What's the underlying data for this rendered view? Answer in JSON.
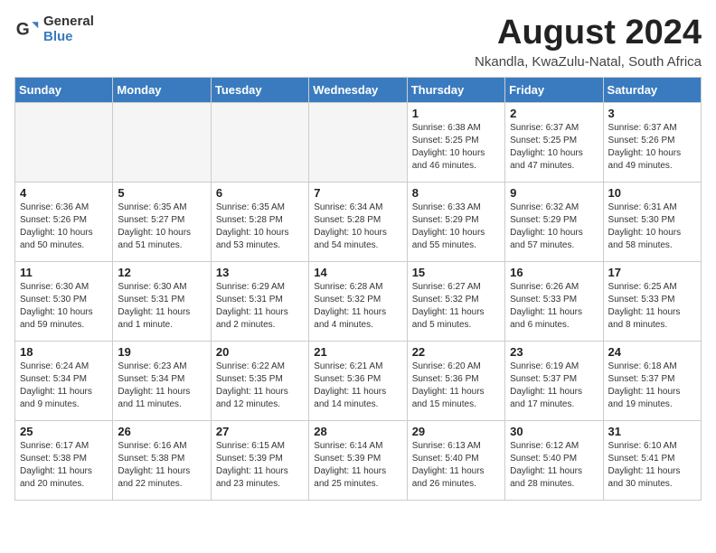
{
  "logo": {
    "general": "General",
    "blue": "Blue"
  },
  "title": "August 2024",
  "location": "Nkandla, KwaZulu-Natal, South Africa",
  "weekdays": [
    "Sunday",
    "Monday",
    "Tuesday",
    "Wednesday",
    "Thursday",
    "Friday",
    "Saturday"
  ],
  "weeks": [
    [
      {
        "day": "",
        "info": ""
      },
      {
        "day": "",
        "info": ""
      },
      {
        "day": "",
        "info": ""
      },
      {
        "day": "",
        "info": ""
      },
      {
        "day": "1",
        "info": "Sunrise: 6:38 AM\nSunset: 5:25 PM\nDaylight: 10 hours\nand 46 minutes."
      },
      {
        "day": "2",
        "info": "Sunrise: 6:37 AM\nSunset: 5:25 PM\nDaylight: 10 hours\nand 47 minutes."
      },
      {
        "day": "3",
        "info": "Sunrise: 6:37 AM\nSunset: 5:26 PM\nDaylight: 10 hours\nand 49 minutes."
      }
    ],
    [
      {
        "day": "4",
        "info": "Sunrise: 6:36 AM\nSunset: 5:26 PM\nDaylight: 10 hours\nand 50 minutes."
      },
      {
        "day": "5",
        "info": "Sunrise: 6:35 AM\nSunset: 5:27 PM\nDaylight: 10 hours\nand 51 minutes."
      },
      {
        "day": "6",
        "info": "Sunrise: 6:35 AM\nSunset: 5:28 PM\nDaylight: 10 hours\nand 53 minutes."
      },
      {
        "day": "7",
        "info": "Sunrise: 6:34 AM\nSunset: 5:28 PM\nDaylight: 10 hours\nand 54 minutes."
      },
      {
        "day": "8",
        "info": "Sunrise: 6:33 AM\nSunset: 5:29 PM\nDaylight: 10 hours\nand 55 minutes."
      },
      {
        "day": "9",
        "info": "Sunrise: 6:32 AM\nSunset: 5:29 PM\nDaylight: 10 hours\nand 57 minutes."
      },
      {
        "day": "10",
        "info": "Sunrise: 6:31 AM\nSunset: 5:30 PM\nDaylight: 10 hours\nand 58 minutes."
      }
    ],
    [
      {
        "day": "11",
        "info": "Sunrise: 6:30 AM\nSunset: 5:30 PM\nDaylight: 10 hours\nand 59 minutes."
      },
      {
        "day": "12",
        "info": "Sunrise: 6:30 AM\nSunset: 5:31 PM\nDaylight: 11 hours\nand 1 minute."
      },
      {
        "day": "13",
        "info": "Sunrise: 6:29 AM\nSunset: 5:31 PM\nDaylight: 11 hours\nand 2 minutes."
      },
      {
        "day": "14",
        "info": "Sunrise: 6:28 AM\nSunset: 5:32 PM\nDaylight: 11 hours\nand 4 minutes."
      },
      {
        "day": "15",
        "info": "Sunrise: 6:27 AM\nSunset: 5:32 PM\nDaylight: 11 hours\nand 5 minutes."
      },
      {
        "day": "16",
        "info": "Sunrise: 6:26 AM\nSunset: 5:33 PM\nDaylight: 11 hours\nand 6 minutes."
      },
      {
        "day": "17",
        "info": "Sunrise: 6:25 AM\nSunset: 5:33 PM\nDaylight: 11 hours\nand 8 minutes."
      }
    ],
    [
      {
        "day": "18",
        "info": "Sunrise: 6:24 AM\nSunset: 5:34 PM\nDaylight: 11 hours\nand 9 minutes."
      },
      {
        "day": "19",
        "info": "Sunrise: 6:23 AM\nSunset: 5:34 PM\nDaylight: 11 hours\nand 11 minutes."
      },
      {
        "day": "20",
        "info": "Sunrise: 6:22 AM\nSunset: 5:35 PM\nDaylight: 11 hours\nand 12 minutes."
      },
      {
        "day": "21",
        "info": "Sunrise: 6:21 AM\nSunset: 5:36 PM\nDaylight: 11 hours\nand 14 minutes."
      },
      {
        "day": "22",
        "info": "Sunrise: 6:20 AM\nSunset: 5:36 PM\nDaylight: 11 hours\nand 15 minutes."
      },
      {
        "day": "23",
        "info": "Sunrise: 6:19 AM\nSunset: 5:37 PM\nDaylight: 11 hours\nand 17 minutes."
      },
      {
        "day": "24",
        "info": "Sunrise: 6:18 AM\nSunset: 5:37 PM\nDaylight: 11 hours\nand 19 minutes."
      }
    ],
    [
      {
        "day": "25",
        "info": "Sunrise: 6:17 AM\nSunset: 5:38 PM\nDaylight: 11 hours\nand 20 minutes."
      },
      {
        "day": "26",
        "info": "Sunrise: 6:16 AM\nSunset: 5:38 PM\nDaylight: 11 hours\nand 22 minutes."
      },
      {
        "day": "27",
        "info": "Sunrise: 6:15 AM\nSunset: 5:39 PM\nDaylight: 11 hours\nand 23 minutes."
      },
      {
        "day": "28",
        "info": "Sunrise: 6:14 AM\nSunset: 5:39 PM\nDaylight: 11 hours\nand 25 minutes."
      },
      {
        "day": "29",
        "info": "Sunrise: 6:13 AM\nSunset: 5:40 PM\nDaylight: 11 hours\nand 26 minutes."
      },
      {
        "day": "30",
        "info": "Sunrise: 6:12 AM\nSunset: 5:40 PM\nDaylight: 11 hours\nand 28 minutes."
      },
      {
        "day": "31",
        "info": "Sunrise: 6:10 AM\nSunset: 5:41 PM\nDaylight: 11 hours\nand 30 minutes."
      }
    ]
  ]
}
